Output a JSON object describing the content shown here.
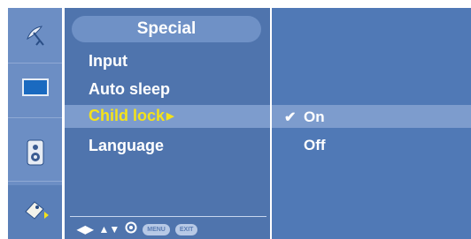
{
  "menu": {
    "title": "Special",
    "items": [
      {
        "label": "Input"
      },
      {
        "label": "Auto sleep"
      },
      {
        "label": "Child lock"
      },
      {
        "label": "Language"
      }
    ],
    "selected_index": 2
  },
  "options": {
    "items": [
      {
        "label": "On",
        "checked": true
      },
      {
        "label": "Off",
        "checked": false
      }
    ]
  },
  "footer": {
    "menu_button": "MENU",
    "exit_button": "EXIT"
  },
  "icons": [
    "satellite-dish-icon",
    "picture-screen-icon",
    "sound-speaker-icon",
    "special-tag-icon"
  ],
  "colors": {
    "selected_text": "#f4e21a",
    "panel": "#4f74ad",
    "highlight": "#7d9ccd"
  }
}
